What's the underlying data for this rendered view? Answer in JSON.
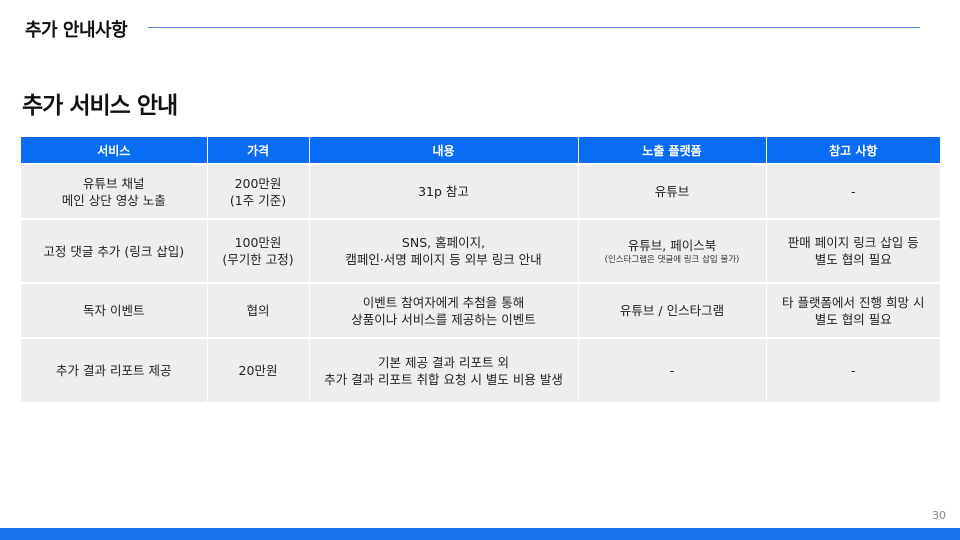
{
  "header": {
    "title": "추가 안내사항"
  },
  "section": {
    "title": "추가 서비스 안내"
  },
  "table": {
    "columns": [
      "서비스",
      "가격",
      "내용",
      "노출 플랫폼",
      "참고 사항"
    ],
    "rows": [
      {
        "service": [
          "유튜브 채널",
          "메인 상단 영상 노출"
        ],
        "price": [
          "200만원",
          "(1주 기준)"
        ],
        "content": [
          "31p 참고"
        ],
        "platform": [
          "유튜브"
        ],
        "platform_note": "",
        "note": [
          "-"
        ]
      },
      {
        "service": [
          "고정 댓글 추가 (링크 삽입)"
        ],
        "price": [
          "100만원",
          "(무기한 고정)"
        ],
        "content": [
          "SNS, 홈페이지,",
          "캠페인·서명 페이지 등 외부 링크 안내"
        ],
        "platform": [
          "유튜브, 페이스북"
        ],
        "platform_note": "(인스타그램은 댓글에 링크 삽입 불가)",
        "note": [
          "판매 페이지 링크 삽입 등",
          "별도 협의 필요"
        ]
      },
      {
        "service": [
          "독자 이벤트"
        ],
        "price": [
          "협의"
        ],
        "content": [
          "이벤트 참여자에게 추첨을 통해",
          "상품이나 서비스를 제공하는 이벤트"
        ],
        "platform": [
          "유튜브 / 인스타그램"
        ],
        "platform_note": "",
        "note": [
          "타 플랫폼에서 진행 희망 시",
          "별도 협의 필요"
        ]
      },
      {
        "service": [
          "추가 결과 리포트 제공"
        ],
        "price": [
          "20만원"
        ],
        "content": [
          "기본 제공 결과 리포트 외",
          "추가 결과 리포트 취합 요청 시 별도 비용 발생"
        ],
        "platform": [
          "-"
        ],
        "platform_note": "",
        "note": [
          "-"
        ]
      }
    ]
  },
  "footer": {
    "page_number": "30"
  },
  "colors": {
    "header_bg": "#0a6cf2",
    "cell_bg": "#eeeeee",
    "accent_bar": "#1a73e8"
  }
}
